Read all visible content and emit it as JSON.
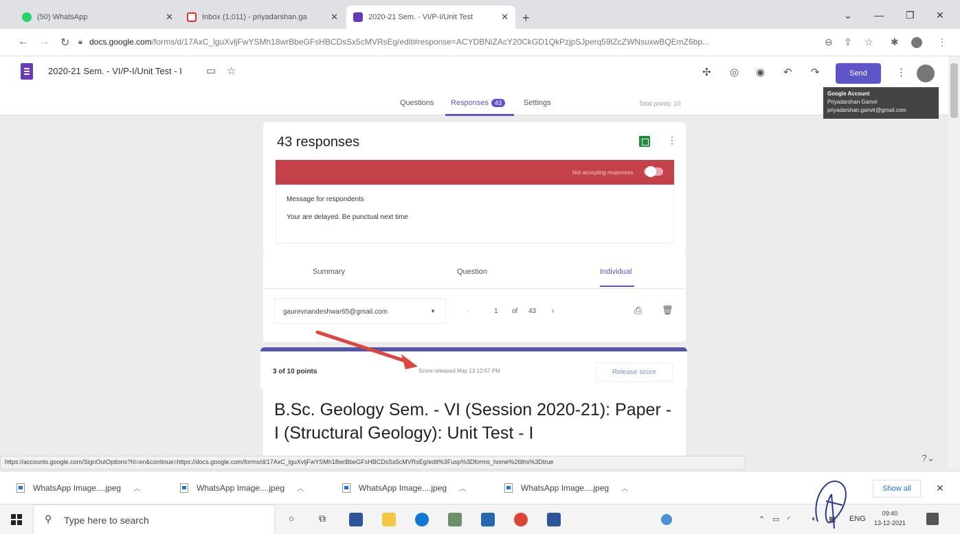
{
  "browser": {
    "tabs": [
      {
        "title": "(50) WhatsApp",
        "color": "#25d366"
      },
      {
        "title": "Inbox (1,011) - priyadarshan.ga",
        "color": "#d93025"
      },
      {
        "title": "2020-21 Sem. - VI/P-I/Unit Test",
        "color": "#673ab7"
      }
    ],
    "new_tab": "+",
    "url_host": "docs.google.com",
    "url_path": "/forms/d/17AxC_lguXvljFwYSMh18wrBbeGFsHBCDsSx5cMVRsEg/edit#response=ACYDBNiZAcY20CkGD1QkPzjpSJperq59lZcZWNsuxwBQEmZ6bp..."
  },
  "forms_header": {
    "title": "2020-21 Sem. - VI/P-I/Unit Test - I",
    "send_label": "Send",
    "tabs": {
      "questions": "Questions",
      "responses": "Responses",
      "responses_count": "43",
      "settings": "Settings"
    },
    "total_points": "Total points: 10"
  },
  "tooltip": {
    "heading": "Google Account",
    "name": "Priyadarshan Ganvir",
    "email": "priyadarshan.ganvir@gmail.com"
  },
  "responses_card": {
    "title": "43 responses",
    "not_accepting": "Not accepting responses",
    "message_label": "Message for respondents",
    "message_text": "Your are delayed. Be punctual next time"
  },
  "subtabs": {
    "summary": "Summary",
    "question": "Question",
    "individual": "Individual"
  },
  "respondent": {
    "email": "gaurevnandeshwar65@gmail.com",
    "page": "1",
    "of": "of",
    "total": "43"
  },
  "score_card": {
    "points": "3 of 10 points",
    "released": "Score released May 13 12:57 PM",
    "release_button": "Release score"
  },
  "form_heading": "B.Sc. Geology Sem. - VI (Session 2020-21): Paper - I (Structural Geology): Unit Test - I",
  "status_url": "https://accounts.google.com/SignOutOptions?hl=en&continue=https://docs.google.com/forms/d/17AxC_lguXvljFwYSMh18wrBbeGFsHBCDsSx5cMVRsEg/edit%3Fusp%3Dforms_home%26ths%3Dtrue",
  "downloads": {
    "items": [
      "WhatsApp Image....jpeg",
      "WhatsApp Image....jpeg",
      "WhatsApp Image....jpeg",
      "WhatsApp Image....jpeg"
    ],
    "show_all": "Show all"
  },
  "taskbar": {
    "search_placeholder": "Type here to search",
    "lang": "ENG",
    "time": "09:40",
    "date": "13-12-2021"
  },
  "colors": {
    "accent": "#5e55c9",
    "red_banner": "#c5414a"
  }
}
